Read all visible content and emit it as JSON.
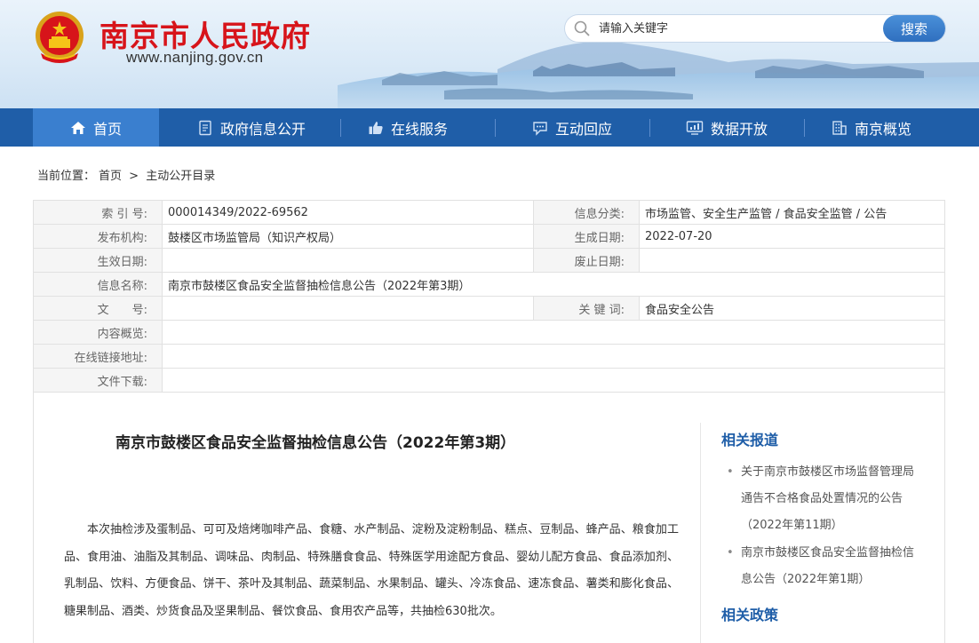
{
  "header": {
    "site_title": "南京市人民政府",
    "site_url": "www.nanjing.gov.cn",
    "search_placeholder": "请输入关键字",
    "search_button": "搜索"
  },
  "nav": {
    "items": [
      {
        "label": "首页",
        "icon": "home-icon"
      },
      {
        "label": "政府信息公开",
        "icon": "document-icon"
      },
      {
        "label": "在线服务",
        "icon": "thumbs-up-icon"
      },
      {
        "label": "互动回应",
        "icon": "chat-icon"
      },
      {
        "label": "数据开放",
        "icon": "chart-icon"
      },
      {
        "label": "南京概览",
        "icon": "building-icon"
      }
    ]
  },
  "breadcrumb": {
    "prefix": "当前位置：",
    "home": "首页",
    "sep": ">",
    "current": "主动公开目录"
  },
  "meta": {
    "index_no_label": "索 引 号:",
    "index_no": "000014349/2022-69562",
    "category_label": "信息分类:",
    "category": "市场监管、安全生产监管 / 食品安全监管 / 公告",
    "publisher_label": "发布机构:",
    "publisher": "鼓楼区市场监管局（知识产权局）",
    "created_label": "生成日期:",
    "created": "2022-07-20",
    "effective_label": "生效日期:",
    "abolished_label": "废止日期:",
    "name_label": "信息名称:",
    "name": "南京市鼓楼区食品安全监督抽检信息公告（2022年第3期）",
    "doc_no_label": "文　　号:",
    "keywords_label": "关 键 词:",
    "keywords": "食品安全公告",
    "summary_label": "内容概览:",
    "link_label": "在线链接地址:",
    "download_label": "文件下载:"
  },
  "article": {
    "title": "南京市鼓楼区食品安全监督抽检信息公告（2022年第3期）",
    "body": "本次抽检涉及蛋制品、可可及焙烤咖啡产品、食糖、水产制品、淀粉及淀粉制品、糕点、豆制品、蜂产品、粮食加工品、食用油、油脂及其制品、调味品、肉制品、特殊膳食食品、特殊医学用途配方食品、婴幼儿配方食品、食品添加剂、乳制品、饮料、方便食品、饼干、茶叶及其制品、蔬菜制品、水果制品、罐头、冷冻食品、速冻食品、薯类和膨化食品、糖果制品、酒类、炒货食品及坚果制品、餐饮食品、食用农产品等，共抽检630批次。"
  },
  "sidebar": {
    "related_reports_title": "相关报道",
    "related_reports": [
      "关于南京市鼓楼区市场监督管理局通告不合格食品处置情况的公告（2022年第11期）",
      "南京市鼓楼区食品安全监督抽检信息公告（2022年第1期）"
    ],
    "related_policies_title": "相关政策"
  },
  "colors": {
    "brand_red": "#d7141a",
    "nav_blue": "#1f5ea8",
    "nav_active": "#3a7fcf"
  }
}
